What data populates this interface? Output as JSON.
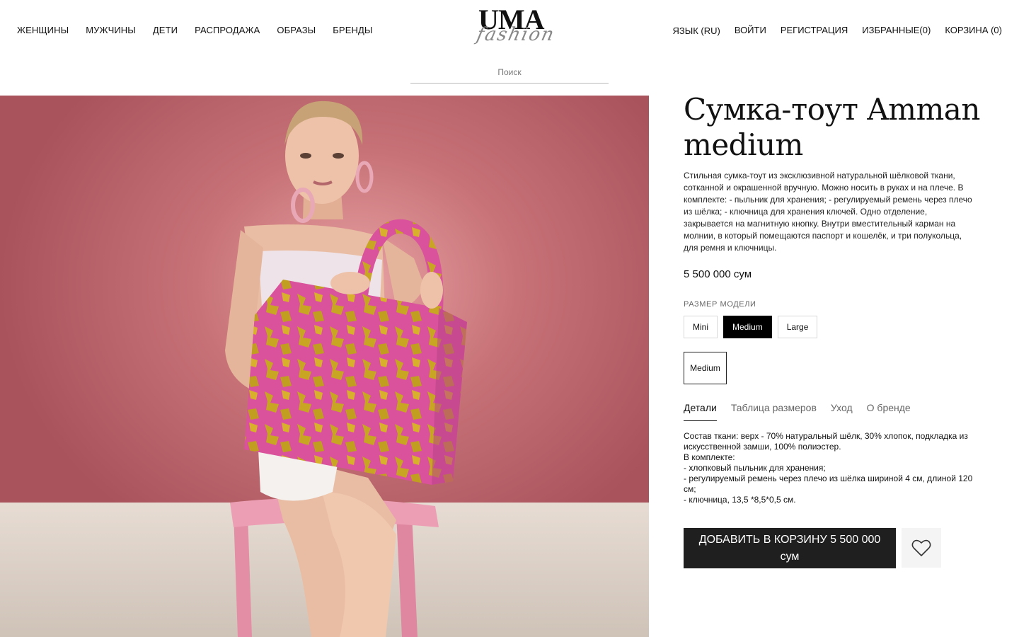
{
  "header": {
    "nav_left": [
      "ЖЕНЩИНЫ",
      "МУЖЧИНЫ",
      "ДЕТИ",
      "РАСПРОДАЖА",
      "ОБРАЗЫ",
      "БРЕНДЫ"
    ],
    "logo_main": "UMA",
    "logo_sub": "fashion",
    "language": "ЯЗЫК (RU)",
    "login": "ВОЙТИ",
    "register": "РЕГИСТРАЦИЯ",
    "favorites": "ИЗБРАННЫЕ(0)",
    "cart": "КОРЗИНА (0)",
    "search_placeholder": "Поиск"
  },
  "product": {
    "title": "Сумка-тоут Amman medium",
    "description": "Стильная сумка-тоут из эксклюзивной натуральной шёлковой ткани, сотканной и окрашенной вручную. Можно носить в руках и на плече. В комплекте: - пыльник для хранения; - регулируемый ремень через плечо из шёлка; - ключница для хранения ключей. Одно отделение, закрывается на магнитную кнопку. Внутри вместительный карман на молнии, в который помещаются паспорт и кошелёк, и три полукольца, для ремня и ключницы.",
    "price": "5 500 000 сум",
    "size_label": "РАЗМЕР МОДЕЛИ",
    "sizes": [
      "Mini",
      "Medium",
      "Large"
    ],
    "selected_size": "Medium",
    "variant": "Medium",
    "tabs": [
      "Детали",
      "Таблица размеров",
      "Уход",
      "О бренде"
    ],
    "active_tab": "Детали",
    "details": [
      "Состав ткани: верх - 70% натуральный шёлк, 30% хлопок, подкладка из искусственной замши, 100% полиэстер.",
      "В комплекте:",
      "- хлопковый пыльник для хранения;",
      "- регулируемый ремень через плечо из шёлка шириной 4 см, длиной 120 см;",
      "- ключница, 13,5 *8,5*0,5 см."
    ],
    "add_to_cart": "ДОБАВИТЬ В КОРЗИНУ 5 500 000 сум"
  },
  "colors": {
    "background_wall": "#b8626b",
    "button_dark": "#1f1f1f",
    "bag_pink": "#d9529b",
    "bag_gold": "#c9a524"
  },
  "icons": [
    "heart-icon"
  ]
}
